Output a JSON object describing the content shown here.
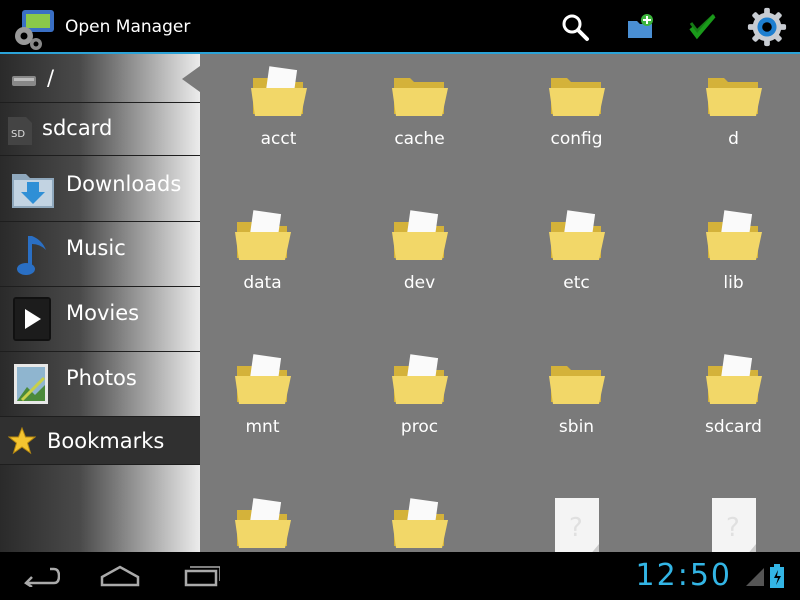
{
  "app": {
    "title": "Open Manager"
  },
  "actionbar": {
    "icons": [
      "search-icon",
      "new-folder-icon",
      "multi-select-icon",
      "settings-icon"
    ]
  },
  "sidebar": {
    "items": [
      {
        "label": "/",
        "icon": "drive-icon"
      },
      {
        "label": "sdcard",
        "icon": "sdcard-icon"
      },
      {
        "label": "Downloads",
        "icon": "downloads-icon"
      },
      {
        "label": "Music",
        "icon": "music-icon"
      },
      {
        "label": "Movies",
        "icon": "movies-icon"
      },
      {
        "label": "Photos",
        "icon": "photos-icon"
      },
      {
        "label": "Bookmarks",
        "icon": "star-icon"
      }
    ]
  },
  "files": [
    {
      "name": "acct",
      "type": "folder"
    },
    {
      "name": "cache",
      "type": "folder"
    },
    {
      "name": "config",
      "type": "folder"
    },
    {
      "name": "d",
      "type": "folder"
    },
    {
      "name": "data",
      "type": "folder"
    },
    {
      "name": "dev",
      "type": "folder"
    },
    {
      "name": "etc",
      "type": "folder"
    },
    {
      "name": "lib",
      "type": "folder"
    },
    {
      "name": "mnt",
      "type": "folder"
    },
    {
      "name": "proc",
      "type": "folder"
    },
    {
      "name": "sbin",
      "type": "folder"
    },
    {
      "name": "sdcard",
      "type": "folder"
    },
    {
      "name": "",
      "type": "folder"
    },
    {
      "name": "",
      "type": "folder"
    },
    {
      "name": "",
      "type": "file"
    },
    {
      "name": "",
      "type": "file"
    }
  ],
  "statusbar": {
    "time": "12:50"
  },
  "colors": {
    "accent": "#33b5e5",
    "folder": "#f2d768",
    "grid_bg": "#7a7a7a"
  }
}
